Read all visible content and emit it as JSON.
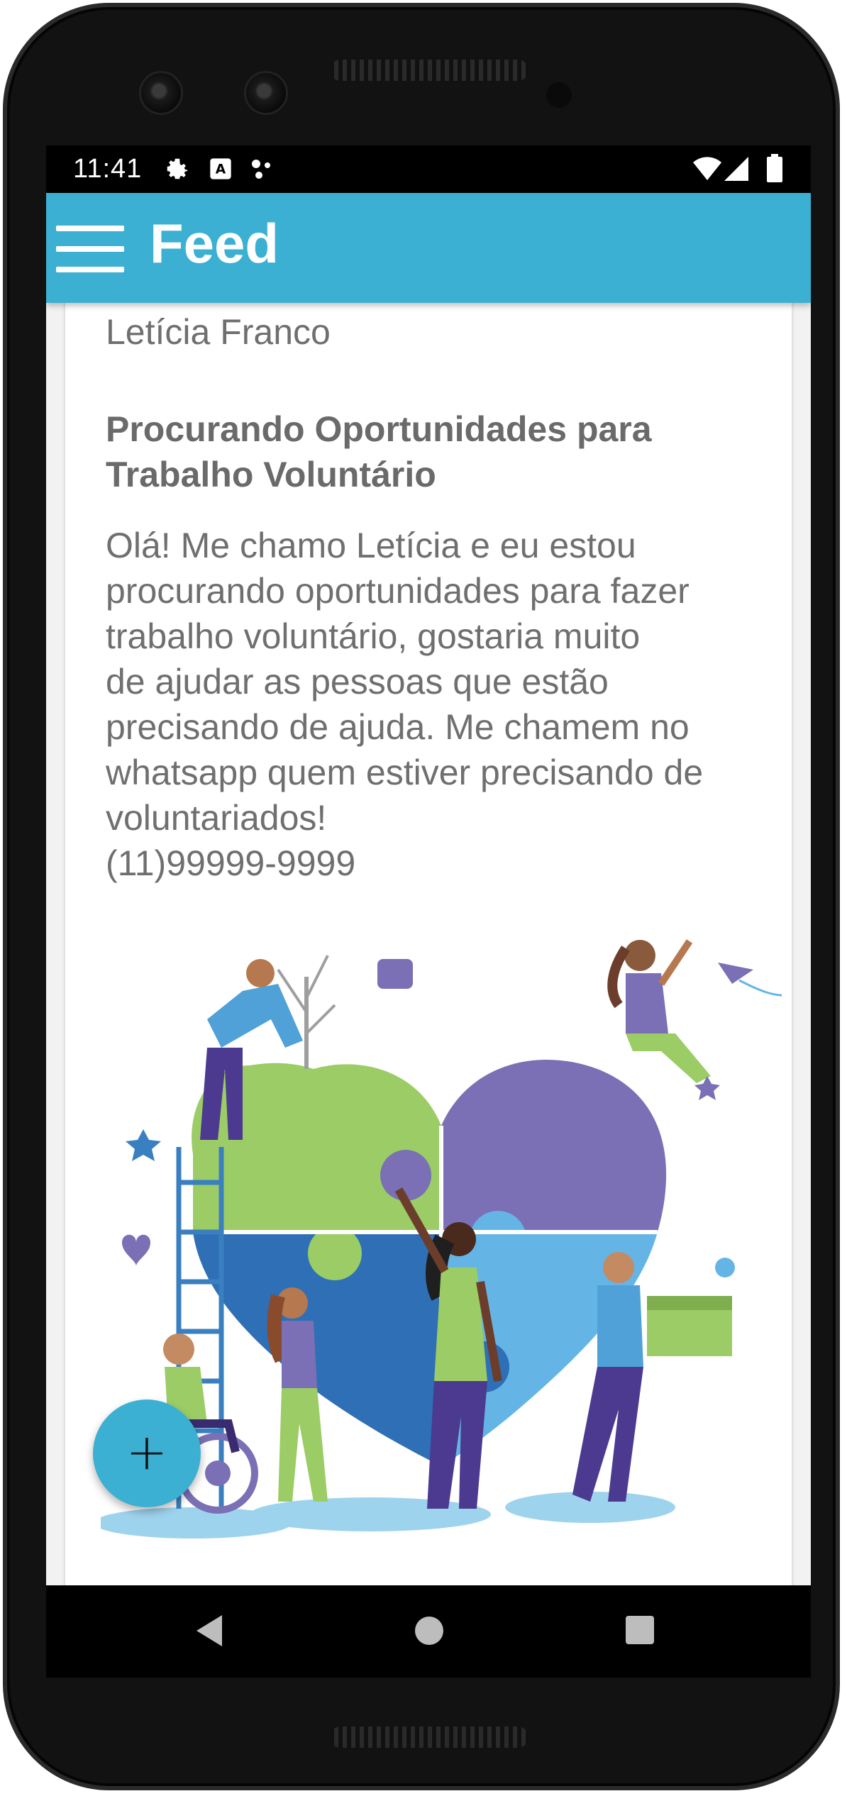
{
  "status_bar": {
    "time": "11:41",
    "icons": [
      "gear-icon",
      "a-accessibility-icon",
      "dots-icon",
      "wifi-icon",
      "signal-icon",
      "battery-icon"
    ]
  },
  "app_bar": {
    "title": "Feed",
    "menu_icon": "hamburger-menu-icon",
    "color": "#3bb0d2"
  },
  "post": {
    "author": "Letícia Franco",
    "title": "Procurando Oportunidades para Trabalho Voluntário",
    "body": "Olá! Me chamo Letícia e eu estou\nprocurando oportunidades para fazer\ntrabalho voluntário, gostaria muito\nde ajudar as pessoas que estão\nprecisando de ajuda. Me chamem no\nwhatsapp quem estiver precisando de\nvoluntariados!\n(11)99999-9999",
    "image": "volunteers-heart-puzzle-illustration"
  },
  "fab": {
    "label": "+",
    "icon": "add-icon"
  },
  "nav_bar": {
    "icons": [
      "back-icon",
      "home-icon",
      "recents-icon"
    ]
  },
  "colors": {
    "accent": "#3bb0d2",
    "text_gray": "#6f6f6f",
    "green": "#9ccc65",
    "purple": "#7b6fb5",
    "blue": "#64b5e6",
    "dark_blue": "#2f6fb5"
  }
}
